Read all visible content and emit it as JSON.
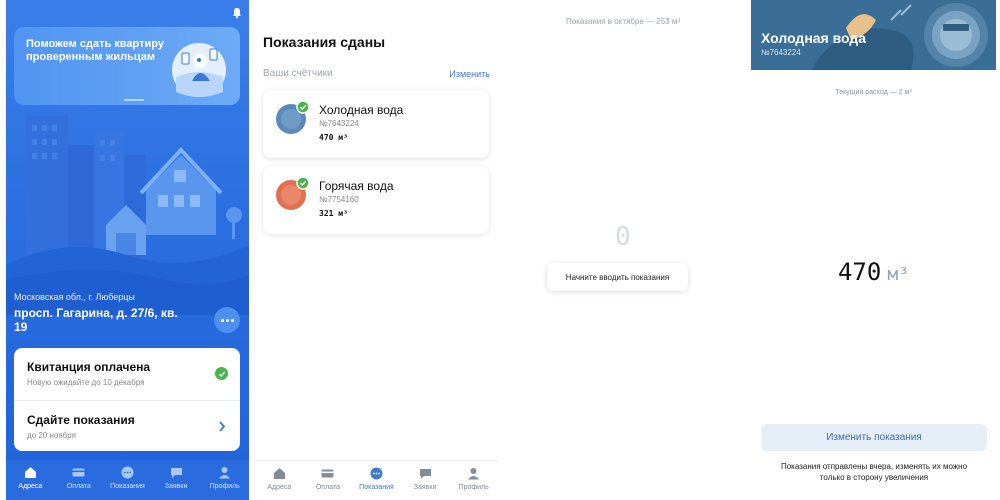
{
  "screen1": {
    "promo": {
      "text": "Поможем сдать квартиру проверенным жильцам"
    },
    "address": {
      "region": "Московская обл., г. Люберцы",
      "street": "просп. Гагарина, д. 27/6, кв. 19"
    },
    "cards": [
      {
        "title": "Квитанция оплачена",
        "subtitle": "Новую ожидайте до 10 декабря",
        "status": "check-icon"
      },
      {
        "title": "Сдайте показания",
        "subtitle": "до 20 ноября",
        "status": "chevron-right-icon"
      }
    ],
    "tabs": [
      {
        "label": "Адреса",
        "icon": "home-icon",
        "active": true
      },
      {
        "label": "Оплата",
        "icon": "card-icon",
        "active": false
      },
      {
        "label": "Показания",
        "icon": "meter-icon",
        "active": false
      },
      {
        "label": "Заявки",
        "icon": "chat-icon",
        "active": false
      },
      {
        "label": "Профиль",
        "icon": "user-icon",
        "active": false
      }
    ]
  },
  "screen2": {
    "title": "Показания сданы",
    "section_label": "Ваши счётчики",
    "edit_label": "Изменить",
    "meters": [
      {
        "title": "Холодная вода",
        "number": "№7643224",
        "value": "470 м³",
        "color": "#5b8ab8"
      },
      {
        "title": "Горячая вода",
        "number": "№7754160",
        "value": "321 м³",
        "color": "#e07050"
      }
    ],
    "tabs": [
      {
        "label": "Адреса",
        "icon": "home-icon",
        "active": false
      },
      {
        "label": "Оплата",
        "icon": "card-icon",
        "active": false
      },
      {
        "label": "Показания",
        "icon": "meter-icon",
        "active": true
      },
      {
        "label": "Заявки",
        "icon": "chat-icon",
        "active": false
      },
      {
        "label": "Профиль",
        "icon": "user-icon",
        "active": false
      }
    ]
  },
  "screen3": {
    "top_text": "Показания в октябре — 253 м³",
    "digit_placeholder": "0",
    "tooltip": "Начните вводить показания"
  },
  "screen4": {
    "title": "Холодная вода",
    "number": "№7643224",
    "current_rate": "Текущий расход — 2 м³",
    "value": "470",
    "unit": "м³",
    "button_label": "Изменить показания",
    "note": "Показания отправлены вчера, изменять их можно только в сторону увеличения"
  },
  "colors": {
    "brand_blue": "#2a6ee0",
    "accent_link": "#3f7ad1",
    "success": "#4bb34b",
    "header_water": "#3b6e96"
  }
}
